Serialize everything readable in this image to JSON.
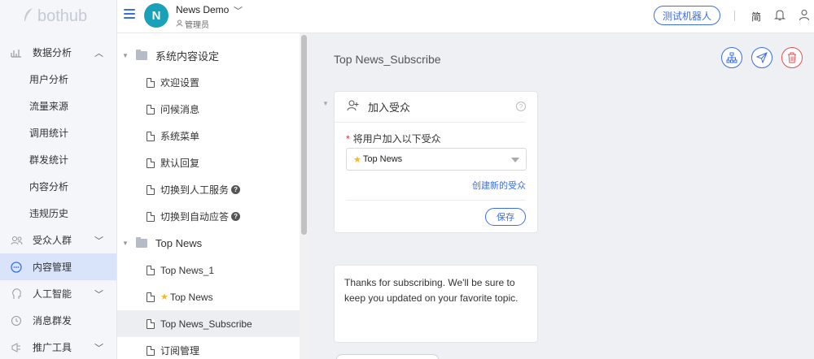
{
  "brand": {
    "logo_text": "bothub"
  },
  "sidebar": {
    "groups": [
      {
        "label": "数据分析",
        "icon": "chart-icon",
        "expanded": true,
        "items": [
          "用户分析",
          "流量来源",
          "调用统计",
          "群发统计",
          "内容分析",
          "违规历史"
        ]
      },
      {
        "label": "受众人群",
        "icon": "users-icon",
        "expanded": false
      },
      {
        "label": "内容管理",
        "icon": "chat-icon",
        "active": true
      },
      {
        "label": "人工智能",
        "icon": "brain-icon",
        "expanded": false
      },
      {
        "label": "消息群发",
        "icon": "broadcast-icon"
      },
      {
        "label": "推广工具",
        "icon": "promo-icon",
        "expanded": false
      }
    ]
  },
  "header": {
    "bot_initial": "N",
    "bot_name": "News Demo",
    "bot_role": "管理员",
    "test_button": "测试机器人",
    "lang": "简"
  },
  "tree": {
    "folder1": "系统内容设定",
    "folder1_items": [
      "欢迎设置",
      "问候消息",
      "系统菜单",
      "默认回复",
      "切换到人工服务",
      "切换到自动应答"
    ],
    "folder2": "Top News",
    "folder2_items": [
      "Top News_1",
      "Top News",
      "Top News_Subscribe",
      "订阅管理"
    ],
    "selected": "Top News_Subscribe"
  },
  "main": {
    "title": "Top News_Subscribe",
    "card1": {
      "title": "加入受众",
      "required_label": "将用户加入以下受众",
      "select_value": "Top News",
      "create_link": "创建新的受众",
      "save_button": "保存"
    },
    "card2": {
      "text": "Thanks for subscribing. We'll be sure to keep you updated on your favorite topic."
    }
  },
  "colors": {
    "accent": "#3b6fe0",
    "danger": "#e05050",
    "avatar": "#1aa0b8"
  }
}
